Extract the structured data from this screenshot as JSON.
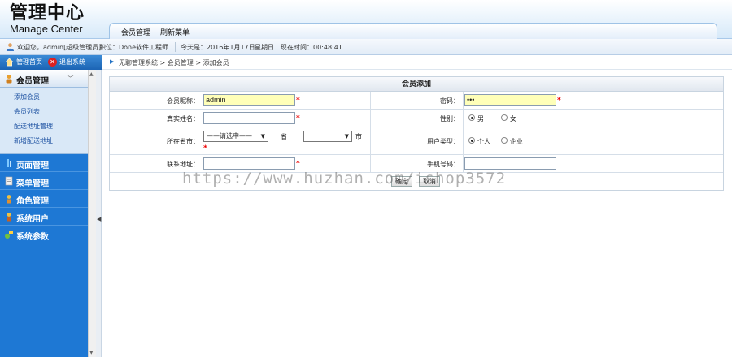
{
  "header": {
    "logo_cn": "管理中心",
    "logo_en": "Manage Center",
    "nav": [
      "会员管理",
      "刷新菜单"
    ]
  },
  "infobar": {
    "welcome": "欢迎您，admin[超级管理员]",
    "role": "职位：Done软件工程师",
    "date": "今天是：2016年1月17日",
    "weekday": "星期日",
    "time": "现在时间：00:48:41"
  },
  "sidetop": {
    "home": "管理首页",
    "exit": "退出系统"
  },
  "sidebar": {
    "active_menu": "会员管理",
    "subitems": [
      "添加会员",
      "会员列表",
      "配送地址管理",
      "新增配送地址"
    ],
    "menus": [
      "页面管理",
      "菜单管理",
      "角色管理",
      "系统用户",
      "系统参数"
    ]
  },
  "breadcrumb": "无聊管理系统 > 会员管理 > 添加会员",
  "form": {
    "title": "会员添加",
    "nickname_label": "会员昵称：",
    "nickname_value": "admin",
    "password_label": "密码：",
    "password_value": "•••",
    "realname_label": "真实姓名：",
    "gender_label": "性别：",
    "gender_options": [
      "男",
      "女"
    ],
    "region_label": "所在省市：",
    "province_select": "——请选中——",
    "province_unit": "省",
    "city_select": "",
    "city_unit": "市",
    "usertype_label": "用户类型：",
    "usertype_options": [
      "个人",
      "企业"
    ],
    "address_label": "联系地址：",
    "mobile_label": "手机号码：",
    "required_mark": "*",
    "confirm": "确定",
    "cancel": "取消"
  },
  "watermark": "https://www.huzhan.com/ishop3572",
  "colors": {
    "sidebar_blue": "#1e78d4",
    "required_red": "#e00000",
    "input_yellow": "#ffffb8"
  }
}
